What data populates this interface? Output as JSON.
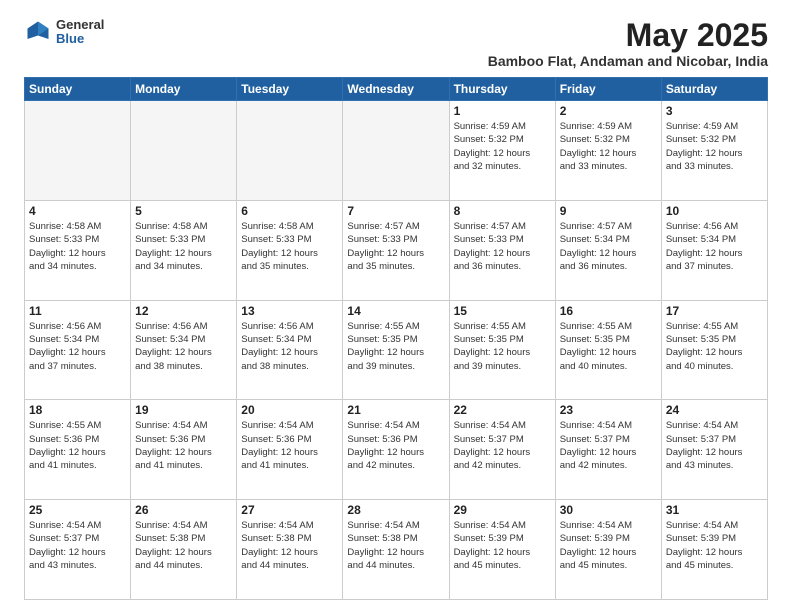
{
  "logo": {
    "general": "General",
    "blue": "Blue"
  },
  "header": {
    "month": "May 2025",
    "location": "Bamboo Flat, Andaman and Nicobar, India"
  },
  "weekdays": [
    "Sunday",
    "Monday",
    "Tuesday",
    "Wednesday",
    "Thursday",
    "Friday",
    "Saturday"
  ],
  "weeks": [
    [
      {
        "day": "",
        "info": ""
      },
      {
        "day": "",
        "info": ""
      },
      {
        "day": "",
        "info": ""
      },
      {
        "day": "",
        "info": ""
      },
      {
        "day": "1",
        "info": "Sunrise: 4:59 AM\nSunset: 5:32 PM\nDaylight: 12 hours\nand 32 minutes."
      },
      {
        "day": "2",
        "info": "Sunrise: 4:59 AM\nSunset: 5:32 PM\nDaylight: 12 hours\nand 33 minutes."
      },
      {
        "day": "3",
        "info": "Sunrise: 4:59 AM\nSunset: 5:32 PM\nDaylight: 12 hours\nand 33 minutes."
      }
    ],
    [
      {
        "day": "4",
        "info": "Sunrise: 4:58 AM\nSunset: 5:33 PM\nDaylight: 12 hours\nand 34 minutes."
      },
      {
        "day": "5",
        "info": "Sunrise: 4:58 AM\nSunset: 5:33 PM\nDaylight: 12 hours\nand 34 minutes."
      },
      {
        "day": "6",
        "info": "Sunrise: 4:58 AM\nSunset: 5:33 PM\nDaylight: 12 hours\nand 35 minutes."
      },
      {
        "day": "7",
        "info": "Sunrise: 4:57 AM\nSunset: 5:33 PM\nDaylight: 12 hours\nand 35 minutes."
      },
      {
        "day": "8",
        "info": "Sunrise: 4:57 AM\nSunset: 5:33 PM\nDaylight: 12 hours\nand 36 minutes."
      },
      {
        "day": "9",
        "info": "Sunrise: 4:57 AM\nSunset: 5:34 PM\nDaylight: 12 hours\nand 36 minutes."
      },
      {
        "day": "10",
        "info": "Sunrise: 4:56 AM\nSunset: 5:34 PM\nDaylight: 12 hours\nand 37 minutes."
      }
    ],
    [
      {
        "day": "11",
        "info": "Sunrise: 4:56 AM\nSunset: 5:34 PM\nDaylight: 12 hours\nand 37 minutes."
      },
      {
        "day": "12",
        "info": "Sunrise: 4:56 AM\nSunset: 5:34 PM\nDaylight: 12 hours\nand 38 minutes."
      },
      {
        "day": "13",
        "info": "Sunrise: 4:56 AM\nSunset: 5:34 PM\nDaylight: 12 hours\nand 38 minutes."
      },
      {
        "day": "14",
        "info": "Sunrise: 4:55 AM\nSunset: 5:35 PM\nDaylight: 12 hours\nand 39 minutes."
      },
      {
        "day": "15",
        "info": "Sunrise: 4:55 AM\nSunset: 5:35 PM\nDaylight: 12 hours\nand 39 minutes."
      },
      {
        "day": "16",
        "info": "Sunrise: 4:55 AM\nSunset: 5:35 PM\nDaylight: 12 hours\nand 40 minutes."
      },
      {
        "day": "17",
        "info": "Sunrise: 4:55 AM\nSunset: 5:35 PM\nDaylight: 12 hours\nand 40 minutes."
      }
    ],
    [
      {
        "day": "18",
        "info": "Sunrise: 4:55 AM\nSunset: 5:36 PM\nDaylight: 12 hours\nand 41 minutes."
      },
      {
        "day": "19",
        "info": "Sunrise: 4:54 AM\nSunset: 5:36 PM\nDaylight: 12 hours\nand 41 minutes."
      },
      {
        "day": "20",
        "info": "Sunrise: 4:54 AM\nSunset: 5:36 PM\nDaylight: 12 hours\nand 41 minutes."
      },
      {
        "day": "21",
        "info": "Sunrise: 4:54 AM\nSunset: 5:36 PM\nDaylight: 12 hours\nand 42 minutes."
      },
      {
        "day": "22",
        "info": "Sunrise: 4:54 AM\nSunset: 5:37 PM\nDaylight: 12 hours\nand 42 minutes."
      },
      {
        "day": "23",
        "info": "Sunrise: 4:54 AM\nSunset: 5:37 PM\nDaylight: 12 hours\nand 42 minutes."
      },
      {
        "day": "24",
        "info": "Sunrise: 4:54 AM\nSunset: 5:37 PM\nDaylight: 12 hours\nand 43 minutes."
      }
    ],
    [
      {
        "day": "25",
        "info": "Sunrise: 4:54 AM\nSunset: 5:37 PM\nDaylight: 12 hours\nand 43 minutes."
      },
      {
        "day": "26",
        "info": "Sunrise: 4:54 AM\nSunset: 5:38 PM\nDaylight: 12 hours\nand 44 minutes."
      },
      {
        "day": "27",
        "info": "Sunrise: 4:54 AM\nSunset: 5:38 PM\nDaylight: 12 hours\nand 44 minutes."
      },
      {
        "day": "28",
        "info": "Sunrise: 4:54 AM\nSunset: 5:38 PM\nDaylight: 12 hours\nand 44 minutes."
      },
      {
        "day": "29",
        "info": "Sunrise: 4:54 AM\nSunset: 5:39 PM\nDaylight: 12 hours\nand 45 minutes."
      },
      {
        "day": "30",
        "info": "Sunrise: 4:54 AM\nSunset: 5:39 PM\nDaylight: 12 hours\nand 45 minutes."
      },
      {
        "day": "31",
        "info": "Sunrise: 4:54 AM\nSunset: 5:39 PM\nDaylight: 12 hours\nand 45 minutes."
      }
    ]
  ]
}
